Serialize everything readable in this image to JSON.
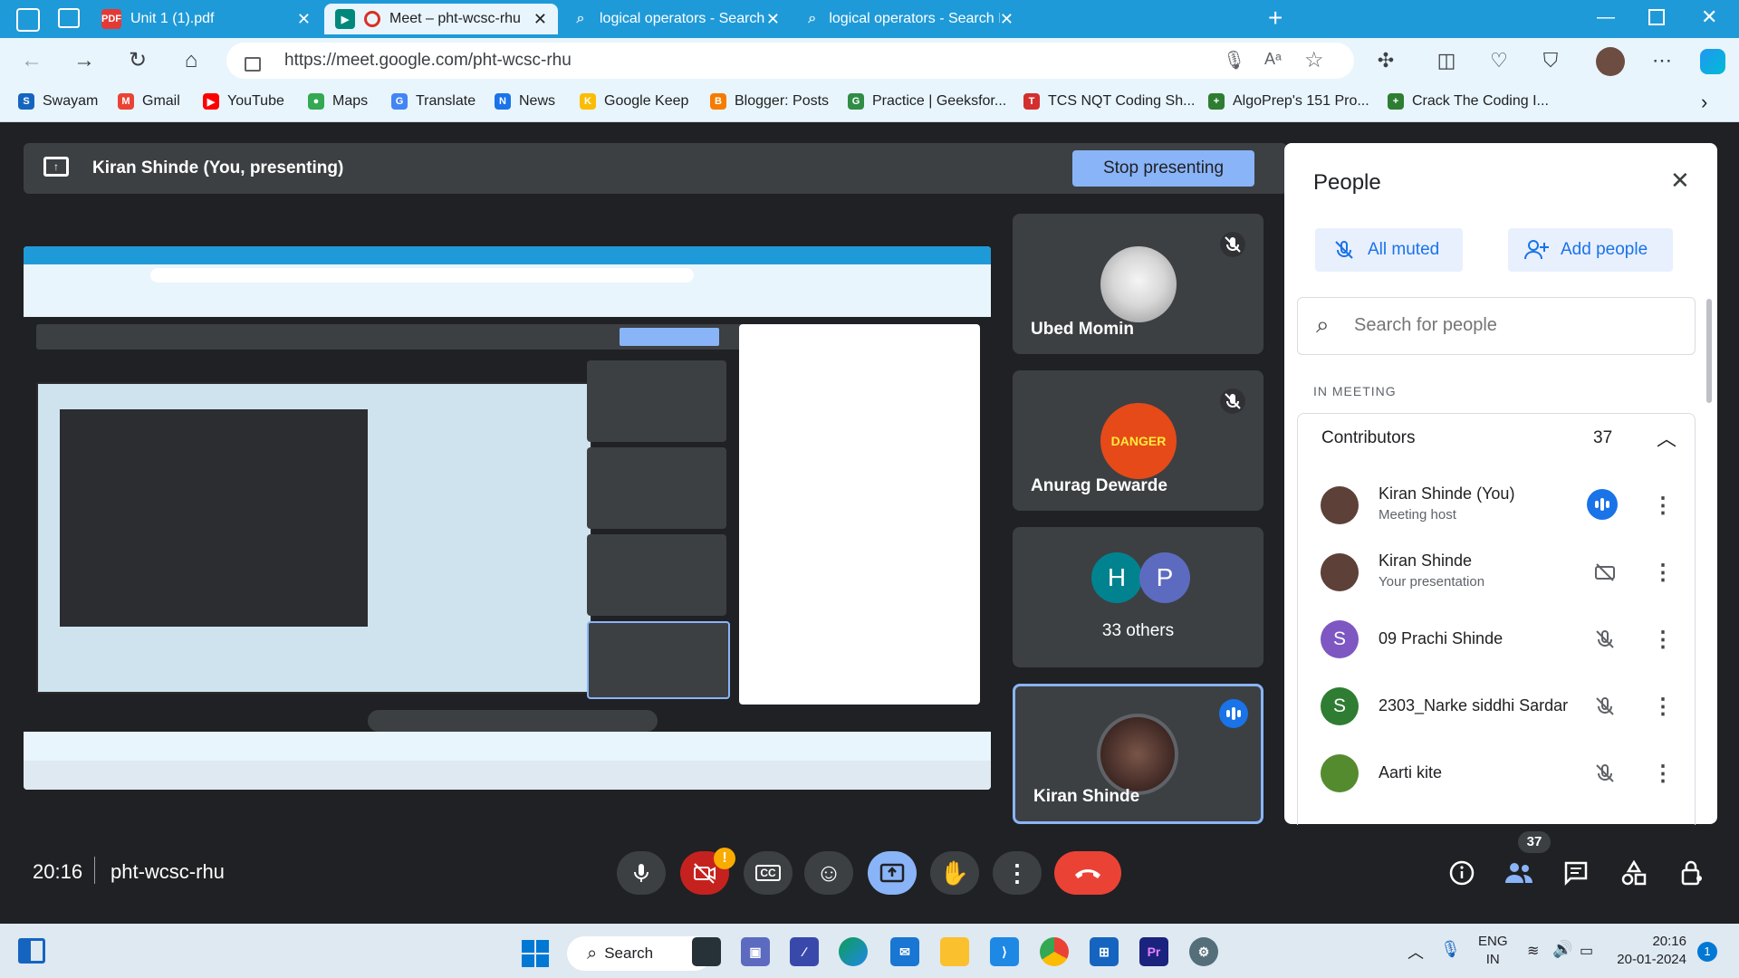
{
  "browser": {
    "tabs": [
      {
        "label": "Unit 1 (1).pdf"
      },
      {
        "label": "Meet – pht-wcsc-rhu"
      },
      {
        "label": "logical operators - Search"
      },
      {
        "label": "logical operators - Search Images"
      }
    ],
    "url": "https://meet.google.com/pht-wcsc-rhu",
    "bookmarks": [
      {
        "label": "Swayam"
      },
      {
        "label": "Gmail"
      },
      {
        "label": "YouTube"
      },
      {
        "label": "Maps"
      },
      {
        "label": "Translate"
      },
      {
        "label": "News"
      },
      {
        "label": "Google Keep"
      },
      {
        "label": "Blogger: Posts"
      },
      {
        "label": "Practice | Geeksfor..."
      },
      {
        "label": "TCS NQT Coding Sh..."
      },
      {
        "label": "AlgoPrep's 151 Pro..."
      },
      {
        "label": "Crack The Coding I..."
      }
    ]
  },
  "meet": {
    "presenting_label": "Kiran Shinde (You, presenting)",
    "stop_presenting": "Stop presenting",
    "tiles": [
      {
        "name": "Ubed Momin"
      },
      {
        "name": "Anurag Dewarde",
        "badge": "DANGER"
      },
      {
        "name": "33 others",
        "initials": [
          "H",
          "P"
        ]
      },
      {
        "name": "Kiran Shinde"
      }
    ],
    "time": "20:16",
    "meeting_code": "pht-wcsc-rhu",
    "people_count": "37",
    "alert": "!"
  },
  "people_panel": {
    "title": "People",
    "all_muted": "All muted",
    "add_people": "Add people",
    "search_placeholder": "Search for people",
    "section": "IN MEETING",
    "group": "Contributors",
    "group_count": "37",
    "participants": [
      {
        "name": "Kiran Shinde (You)",
        "sub": "Meeting host",
        "initial": "",
        "color": "#5d4037"
      },
      {
        "name": "Kiran Shinde",
        "sub": "Your presentation",
        "initial": "",
        "color": "#5d4037"
      },
      {
        "name": "09 Prachi Shinde",
        "sub": "",
        "initial": "S",
        "color": "#7e57c2"
      },
      {
        "name": "2303_Narke siddhi Sardar",
        "sub": "",
        "initial": "S",
        "color": "#2e7d32"
      },
      {
        "name": "Aarti kite",
        "sub": "",
        "initial": "",
        "color": "#558b2f"
      }
    ]
  },
  "taskbar": {
    "search": "Search",
    "lang1": "ENG",
    "lang2": "IN",
    "time": "20:16",
    "date": "20-01-2024",
    "notif": "1"
  },
  "colors": {
    "accent": "#1a73e8",
    "end_call": "#ea4335",
    "present": "#8ab4f8",
    "chrome": "#1f9ad8"
  }
}
